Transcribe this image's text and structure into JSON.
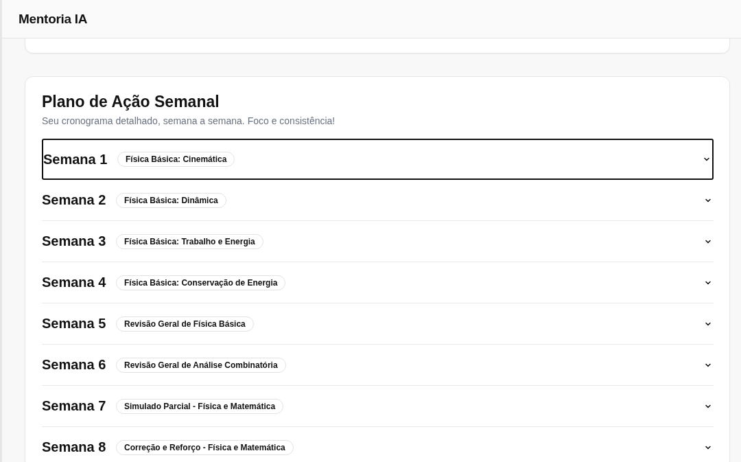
{
  "header": {
    "title": "Mentoria IA"
  },
  "plan": {
    "title": "Plano de Ação Semanal",
    "subtitle": "Seu cronograma detalhado, semana a semana. Foco e consistência!",
    "weeks": [
      {
        "label": "Semana 1",
        "topic": "Física Básica: Cinemática",
        "focused": true,
        "expanded": false
      },
      {
        "label": "Semana 2",
        "topic": "Física Básica: Dinâmica",
        "focused": false,
        "expanded": false
      },
      {
        "label": "Semana 3",
        "topic": "Física Básica: Trabalho e Energia",
        "focused": false,
        "expanded": false
      },
      {
        "label": "Semana 4",
        "topic": "Física Básica: Conservação de Energia",
        "focused": false,
        "expanded": false
      },
      {
        "label": "Semana 5",
        "topic": "Revisão Geral de Física Básica",
        "focused": false,
        "expanded": false
      },
      {
        "label": "Semana 6",
        "topic": "Revisão Geral de Análise Combinatória",
        "focused": false,
        "expanded": false
      },
      {
        "label": "Semana 7",
        "topic": "Simulado Parcial - Física e Matemática",
        "focused": false,
        "expanded": false
      },
      {
        "label": "Semana 8",
        "topic": "Correção e Reforço - Física e Matemática",
        "focused": false,
        "expanded": false
      }
    ]
  }
}
